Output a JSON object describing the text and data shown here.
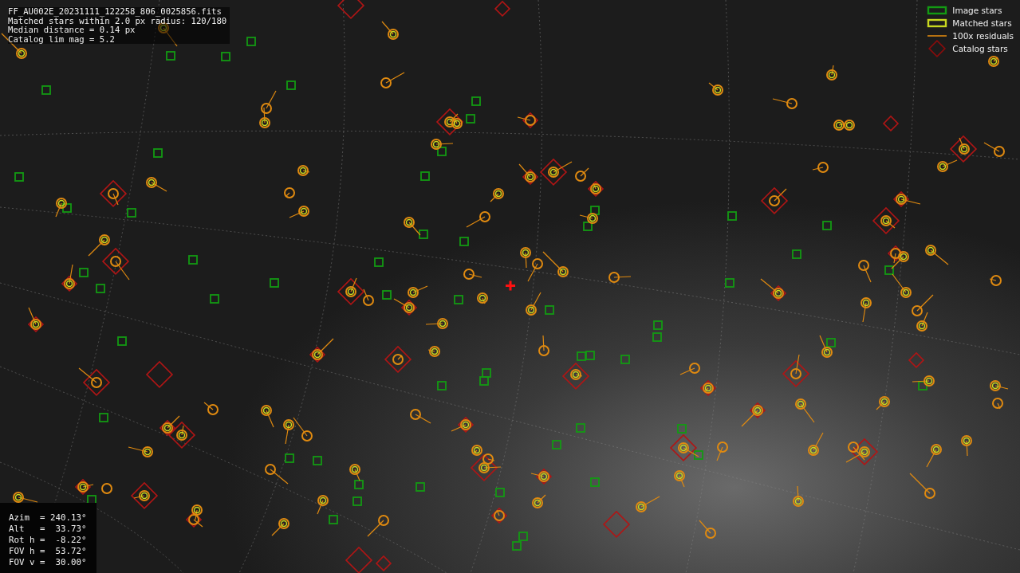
{
  "info": [
    "FF_AU002E_20231111_122258_806_0025856.fits",
    "Matched stars within 2.0 px radius: 120/180",
    "Median distance = 0.14 px",
    "Catalog lim mag = 5.2"
  ],
  "legend": [
    {
      "kind": "image",
      "label": "Image stars"
    },
    {
      "kind": "matched",
      "label": "Matched stars"
    },
    {
      "kind": "residual",
      "label": "100x residuals"
    },
    {
      "kind": "catalog",
      "label": "Catalog stars"
    }
  ],
  "pointing": [
    "Azim  = 240.13°",
    "Alt   =  33.73°",
    "Rot h =  -8.22°",
    "FOV h =  53.72°",
    "FOV v =  30.00°"
  ]
}
